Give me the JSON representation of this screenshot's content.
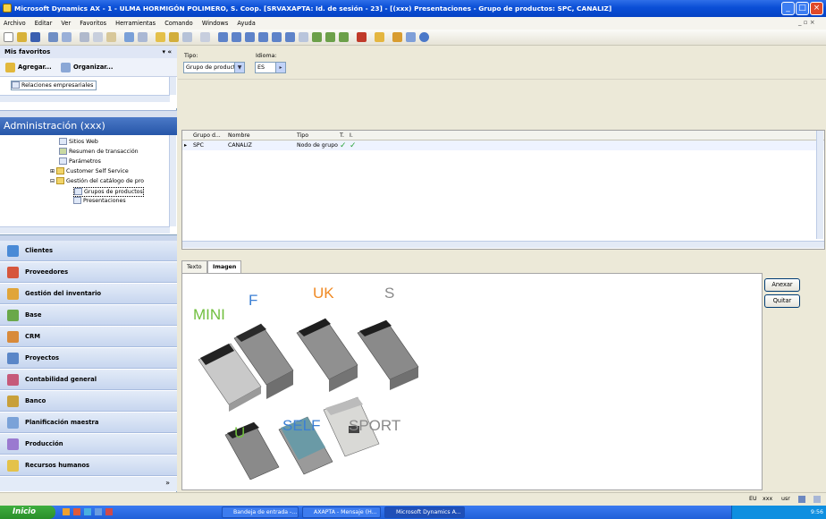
{
  "window": {
    "title": "Microsoft Dynamics AX - 1 - ULMA HORMIGÓN POLIMERO, S. Coop. [SRVAXAPTA: Id. de sesión - 23] - [(xxx) Presentaciones - Grupo de productos: SPC, CANALIZ]"
  },
  "menubar": {
    "items": [
      "Archivo",
      "Editar",
      "Ver",
      "Favoritos",
      "Herramientas",
      "Comando",
      "Windows",
      "Ayuda"
    ]
  },
  "favorites": {
    "header": "Mis favoritos",
    "add_label": "Agregar...",
    "organize_label": "Organizar...",
    "items": [
      "Relaciones empresariales"
    ]
  },
  "admin": {
    "header": "Administración (xxx)",
    "tree": [
      "Sitios Web",
      "Resumen de transacción",
      "Parámetros",
      "Customer Self Service",
      "Gestión del catálogo de pro",
      "Grupos de productos",
      "Presentaciones"
    ]
  },
  "modules": [
    "Clientes",
    "Proveedores",
    "Gestión del inventario",
    "Base",
    "CRM",
    "Proyectos",
    "Contabilidad general",
    "Banco",
    "Planificación maestra",
    "Producción",
    "Recursos humanos"
  ],
  "filter": {
    "tipo_label": "Tipo:",
    "tipo_value": "Grupo de productos",
    "idioma_label": "Idioma:",
    "idioma_value": "ES"
  },
  "grid": {
    "columns": [
      "Grupo d...",
      "Nombre",
      "Tipo",
      "T.",
      "I."
    ],
    "rows": [
      {
        "grupo": "SPC",
        "nombre": "CANALIZ",
        "tipo": "Nodo de grupo",
        "t": "✓",
        "i": "✓"
      }
    ]
  },
  "tabs": [
    "Texto",
    "Imagen"
  ],
  "active_tab": "Imagen",
  "panel_buttons": {
    "anexar": "Anexar",
    "quitar": "Quitar"
  },
  "image_labels": [
    "MINI",
    "F",
    "UK",
    "S",
    "U",
    "SELF",
    "SPORT"
  ],
  "status": {
    "company": "EU",
    "extra": "xxx",
    "user": "usr"
  },
  "taskbar": {
    "start": "Inicio",
    "tasks": [
      "Bandeja de entrada -...",
      "AXAPTA - Mensaje (H...",
      "Microsoft Dynamics A..."
    ],
    "clock": "9:56"
  },
  "colors": {
    "title_blue": "#0a4ed6",
    "label_green": "#6fbe3c",
    "label_blue": "#3b7fd4",
    "label_orange": "#f08a24",
    "label_gray": "#8a8a8a"
  }
}
